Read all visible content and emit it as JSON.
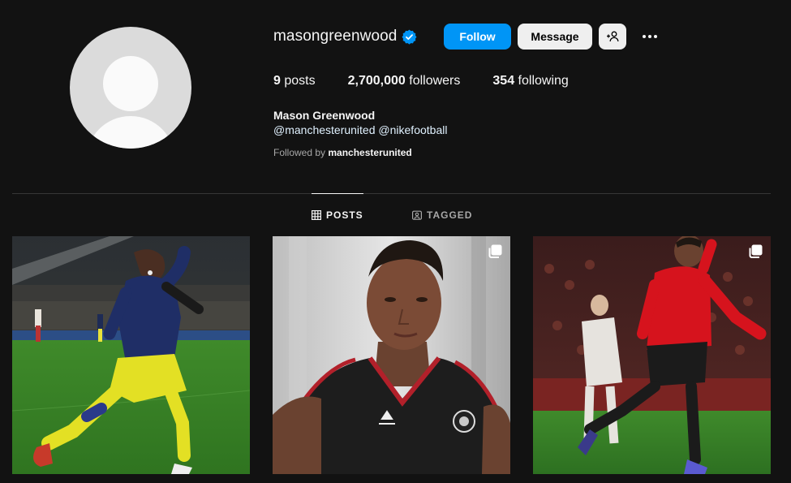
{
  "profile": {
    "username": "masongreenwood",
    "verified": true,
    "follow_label": "Follow",
    "message_label": "Message",
    "full_name": "Mason Greenwood",
    "bio_links": [
      "@manchesterunited",
      "@nikefootball"
    ],
    "followed_by_prefix": "Followed by",
    "followed_by_user": "manchesterunited"
  },
  "stats": {
    "posts_count": "9",
    "posts_label": "posts",
    "followers_count": "2,700,000",
    "followers_label": "followers",
    "following_count": "354",
    "following_label": "following"
  },
  "tabs": [
    {
      "label": "POSTS",
      "icon": "grid-icon",
      "active": true
    },
    {
      "label": "TAGGED",
      "icon": "tagged-icon",
      "active": false
    }
  ],
  "posts": [
    {
      "kind": "single",
      "scene": "player-celebrating-navy-yellow-kit"
    },
    {
      "kind": "carousel",
      "scene": "player-portrait-black-training-vest"
    },
    {
      "kind": "carousel",
      "scene": "player-celebrating-red-kit"
    }
  ],
  "colors": {
    "background": "#121212",
    "follow_button": "#0095f6",
    "secondary_button": "#efefef",
    "verified_badge": "#0095f6",
    "link_text": "#e0f1ff",
    "muted_text": "#a8a8a8"
  }
}
